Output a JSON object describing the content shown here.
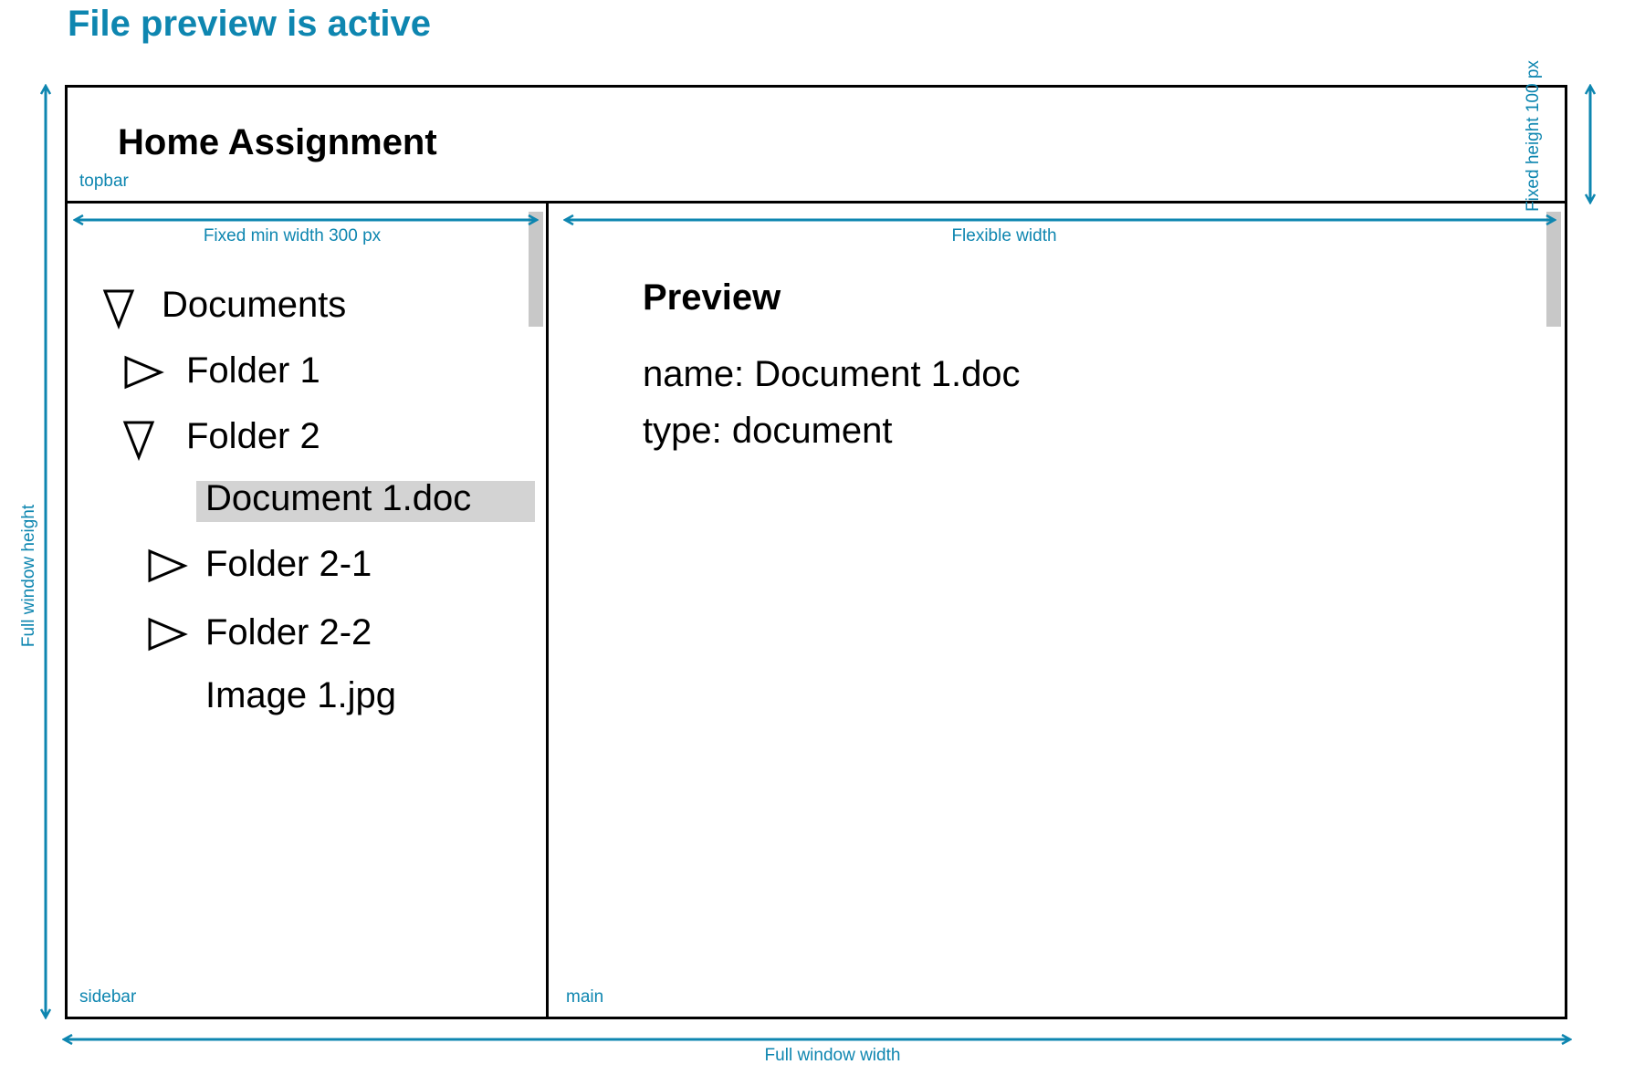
{
  "heading": "File preview is active",
  "topbar": {
    "title": "Home Assignment",
    "region_label": "topbar"
  },
  "sidebar": {
    "region_label": "sidebar",
    "tree": [
      {
        "label": "Documents",
        "state": "expanded",
        "indent": 0
      },
      {
        "label": "Folder 1",
        "state": "collapsed",
        "indent": 1
      },
      {
        "label": "Folder 2",
        "state": "expanded",
        "indent": 1
      },
      {
        "label": "Document 1.doc",
        "state": "file",
        "indent": 2,
        "selected": true
      },
      {
        "label": "Folder 2-1",
        "state": "collapsed",
        "indent": 2
      },
      {
        "label": "Folder 2-2",
        "state": "collapsed",
        "indent": 2
      },
      {
        "label": "Image 1.jpg",
        "state": "file",
        "indent": 2
      }
    ]
  },
  "main": {
    "region_label": "main",
    "preview": {
      "title": "Preview",
      "name_line": "name: Document 1.doc",
      "type_line": "type: document"
    }
  },
  "annotations": {
    "sidebar_width": "Fixed min width 300 px",
    "main_width": "Flexible width",
    "window_height": "Full window height",
    "window_width": "Full window width",
    "topbar_height": "Fixed height 100 px"
  },
  "colors": {
    "accent": "#0e86b0",
    "selected_row": "#d3d3d3",
    "scrollbar": "#c8c8c8"
  }
}
